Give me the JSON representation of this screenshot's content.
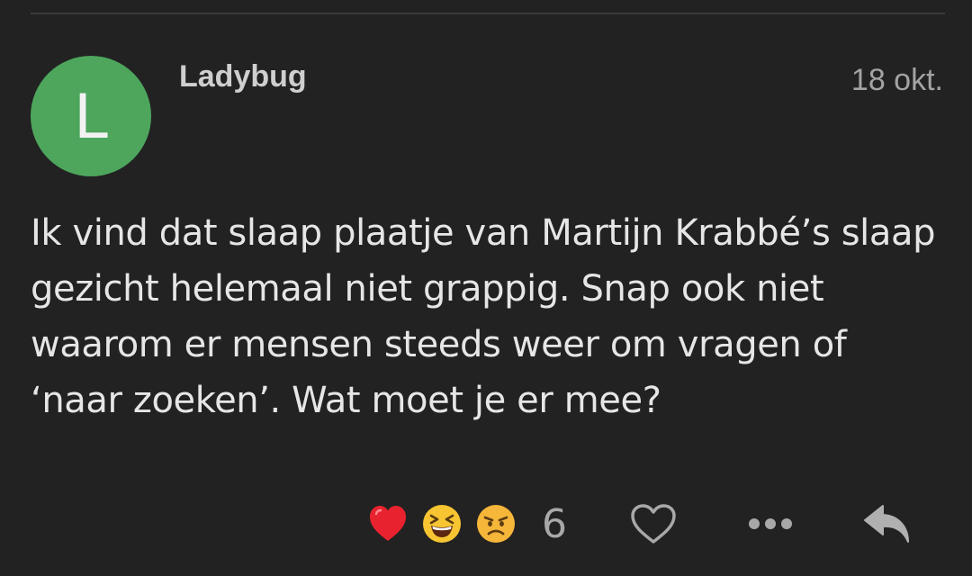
{
  "post": {
    "avatar_letter": "L",
    "author": "Ladybug",
    "date": "18 okt.",
    "body": "Ik vind dat slaap plaatje van Martijn Krabbé’s slaap gezicht helemaal niet grappig. Snap ook niet waarom er mensen steeds weer om vragen of ‘naar zoeken’. Wat moet je er mee?",
    "reactions": [
      "heart-emoji",
      "laughing-emoji",
      "angry-emoji"
    ],
    "reaction_count": "6"
  },
  "colors": {
    "background": "#222222",
    "avatar": "#4da65c",
    "text": "#e6e6e6",
    "muted": "#a3a3a3"
  },
  "icons": {
    "like": "heart-outline-icon",
    "more": "more-dots-icon",
    "reply": "reply-arrow-icon"
  }
}
